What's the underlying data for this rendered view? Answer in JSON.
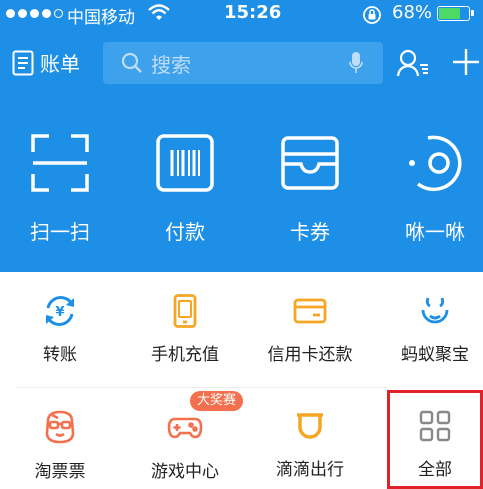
{
  "status_bar": {
    "carrier": "中国移动",
    "time": "15:26",
    "battery_percent": "68%",
    "battery_level": 0.68,
    "battery_color": "#4CD964"
  },
  "header": {
    "bill_label": "账单",
    "bill_icon": "bill-icon",
    "search_placeholder": "搜索",
    "search_icon": "search-icon",
    "mic_icon": "microphone-icon",
    "contacts_icon": "contacts-icon",
    "add_icon": "plus-icon"
  },
  "actions": [
    {
      "label": "扫一扫",
      "icon": "scan-icon"
    },
    {
      "label": "付款",
      "icon": "barcode-icon"
    },
    {
      "label": "卡券",
      "icon": "card-wallet-icon"
    },
    {
      "label": "咻一咻",
      "icon": "xiu-icon"
    }
  ],
  "services": [
    {
      "label": "转账",
      "icon": "transfer-icon"
    },
    {
      "label": "手机充值",
      "icon": "phone-recharge-icon"
    },
    {
      "label": "信用卡还款",
      "icon": "credit-card-icon"
    },
    {
      "label": "蚂蚁聚宝",
      "icon": "ant-fortune-icon"
    },
    {
      "label": "淘票票",
      "icon": "taopiaopiao-icon"
    },
    {
      "label": "游戏中心",
      "icon": "gamepad-icon",
      "badge": "大奖赛"
    },
    {
      "label": "滴滴出行",
      "icon": "didi-icon"
    },
    {
      "label": "全部",
      "icon": "grid-icon"
    }
  ],
  "colors": {
    "primary_blue": "#1E8FE6",
    "search_bg": "#3EA1EC",
    "service_blue": "#1E8FE6",
    "service_orange": "#F5A623",
    "service_red": "#F2704E",
    "badge": "#F2704E",
    "highlight_border": "#E0222A"
  }
}
